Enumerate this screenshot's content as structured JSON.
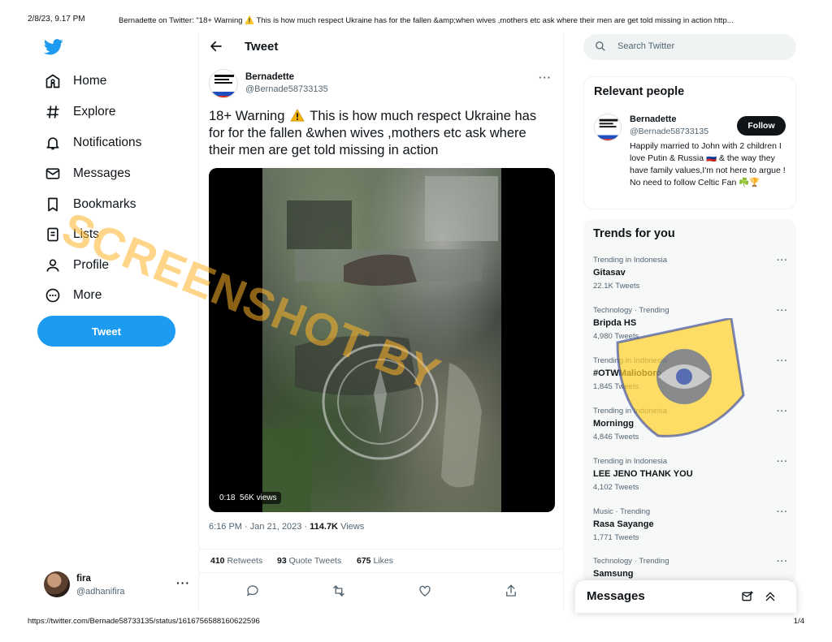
{
  "print": {
    "date": "2/8/23, 9.17 PM",
    "title": "Bernadette on Twitter: \"18+ Warning ⚠️ This is how much respect Ukraine has for the fallen &amp;when wives ,mothers etc ask where their men are get told missing in action http...",
    "url": "https://twitter.com/Bernade58733135/status/1616756588160622596",
    "page": "1/4"
  },
  "nav": {
    "items": [
      {
        "label": "Home",
        "icon": "home-icon"
      },
      {
        "label": "Explore",
        "icon": "hashtag-icon"
      },
      {
        "label": "Notifications",
        "icon": "bell-icon"
      },
      {
        "label": "Messages",
        "icon": "envelope-icon"
      },
      {
        "label": "Bookmarks",
        "icon": "bookmark-icon"
      },
      {
        "label": "Lists",
        "icon": "list-icon"
      },
      {
        "label": "Profile",
        "icon": "person-icon"
      },
      {
        "label": "More",
        "icon": "more-circle-icon"
      }
    ],
    "tweet_button": "Tweet",
    "account": {
      "name": "fira",
      "handle": "@adhanifira",
      "more": "···"
    }
  },
  "main": {
    "title": "Tweet",
    "author": {
      "name": "Bernadette",
      "handle": "@Bernade58733135"
    },
    "text_before": "18+ Warning",
    "text_after": "This is how much respect Ukraine has for for the fallen &when wives ,mothers etc ask where their men are get told missing in action",
    "video": {
      "duration": "0:18",
      "views": "56K views"
    },
    "timestamp": "6:16 PM · Jan 21, 2023 · ",
    "views_count": "114.7K",
    "views_label": " Views",
    "stats": {
      "retweets_count": "410",
      "retweets_label": " Retweets",
      "quotes_count": "93",
      "quotes_label": " Quote Tweets",
      "likes_count": "675",
      "likes_label": " Likes"
    }
  },
  "search": {
    "placeholder": "Search Twitter"
  },
  "relevant": {
    "title": "Relevant people",
    "name": "Bernadette",
    "handle": "@Bernade58733135",
    "follow": "Follow",
    "bio": "Happily married to John with 2 children I love Putin & Russia 🇷🇺 & the way they have family values,I'm not here to argue ! No need to follow Celtic Fan ☘️🏆"
  },
  "trends": {
    "title": "Trends for you",
    "items": [
      {
        "context": "Trending in Indonesia",
        "name": "Gitasav",
        "count": "22.1K Tweets"
      },
      {
        "context": "Technology · Trending",
        "name": "Bripda HS",
        "count": "4,980 Tweets"
      },
      {
        "context": "Trending in Indonesia",
        "name": "#OTWMalioboro",
        "count": "1,845 Tweets"
      },
      {
        "context": "Trending in Indonesia",
        "name": "Morningg",
        "count": "4,846 Tweets"
      },
      {
        "context": "Trending in Indonesia",
        "name": "LEE JENO THANK YOU",
        "count": "4,102 Tweets"
      },
      {
        "context": "Music · Trending",
        "name": "Rasa Sayange",
        "count": "1,771 Tweets"
      },
      {
        "context": "Technology · Trending",
        "name": "Samsung",
        "count": ""
      }
    ]
  },
  "messages_drawer": {
    "title": "Messages"
  },
  "watermark": {
    "text": "SCREENSHOT BY",
    "seal_text": "MASYARAKAT ANTI FITNAH INDONESIA · TURN BACK HOAX · MAFINDO"
  },
  "colors": {
    "accent": "#1d9bf0",
    "watermark": "#ffb428"
  }
}
